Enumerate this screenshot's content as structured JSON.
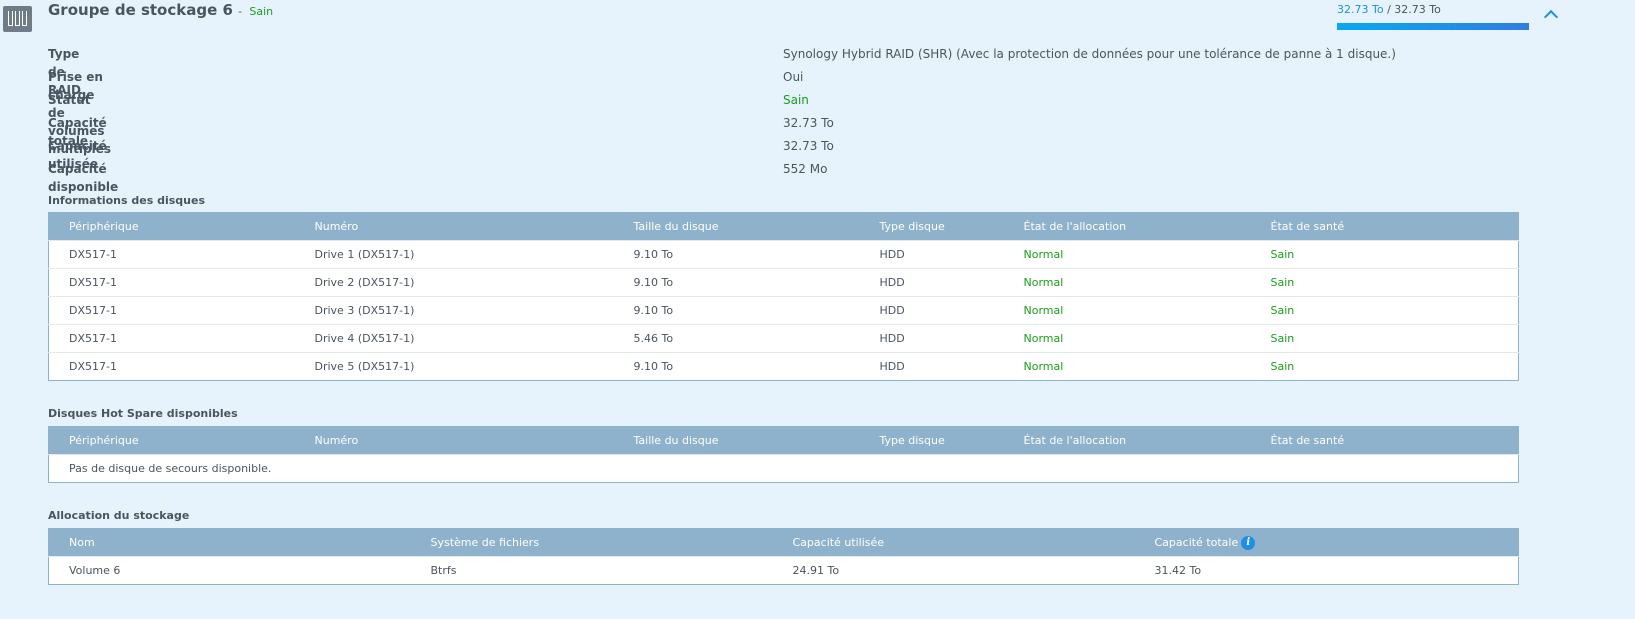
{
  "header": {
    "title": "Groupe de stockage 6",
    "separator": "-",
    "status": "Sain",
    "used": "32.73 To",
    "separator2": "/",
    "total": "32.73 To",
    "usage_percent": 100
  },
  "info": [
    {
      "label": "Type de RAID",
      "value": "Synology Hybrid RAID (SHR) (Avec la protection de données pour une tolérance de panne à 1 disque.)"
    },
    {
      "label": "Prise en charge de volumes multiples",
      "value": "Oui"
    },
    {
      "label": "Statut",
      "value": "Sain"
    },
    {
      "label": "Capacité totale",
      "value": "32.73 To"
    },
    {
      "label": "Capacité utilisée",
      "value": "32.73 To"
    },
    {
      "label": "Capacité disponible",
      "value": "552 Mo"
    }
  ],
  "disks": {
    "title": "Informations des disques",
    "columns": [
      "Périphérique",
      "Numéro",
      "Taille du disque",
      "Type disque",
      "État de l'allocation",
      "État de santé"
    ],
    "rows": [
      [
        "DX517-1",
        "Drive 1 (DX517-1)",
        "9.10 To",
        "HDD",
        "Normal",
        "Sain"
      ],
      [
        "DX517-1",
        "Drive 2 (DX517-1)",
        "9.10 To",
        "HDD",
        "Normal",
        "Sain"
      ],
      [
        "DX517-1",
        "Drive 3 (DX517-1)",
        "9.10 To",
        "HDD",
        "Normal",
        "Sain"
      ],
      [
        "DX517-1",
        "Drive 4 (DX517-1)",
        "5.46 To",
        "HDD",
        "Normal",
        "Sain"
      ],
      [
        "DX517-1",
        "Drive 5 (DX517-1)",
        "9.10 To",
        "HDD",
        "Normal",
        "Sain"
      ]
    ]
  },
  "hotspare": {
    "title": "Disques Hot Spare disponibles",
    "columns": [
      "Périphérique",
      "Numéro",
      "Taille du disque",
      "Type disque",
      "État de l'allocation",
      "État de santé"
    ],
    "empty": "Pas de disque de secours disponible."
  },
  "allocation": {
    "title": "Allocation du stockage",
    "columns": [
      "Nom",
      "Système de fichiers",
      "Capacité utilisée",
      "Capacité totale"
    ],
    "info_icon": "i",
    "rows": [
      [
        "Volume 6",
        "Btrfs",
        "24.91 To",
        "31.42 To"
      ]
    ]
  },
  "colors": {
    "healthy": "#1a9e1a",
    "accent": "#1f8fe6",
    "header": "#8eb2cc"
  }
}
